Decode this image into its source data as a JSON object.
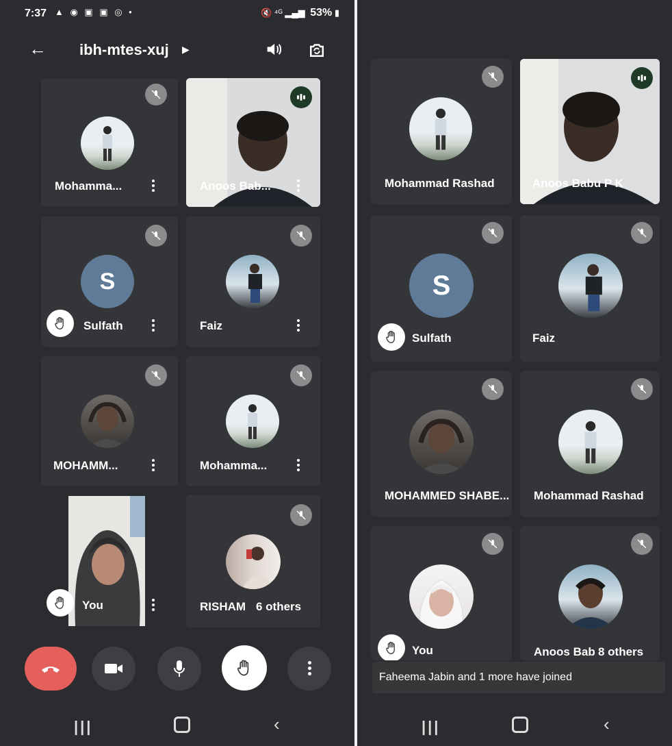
{
  "left": {
    "status": {
      "time": "7:37",
      "battery": "53%"
    },
    "meeting_code": "ibh-mtes-xuj",
    "tiles": [
      {
        "name": "Mohamma..."
      },
      {
        "name": "Anoos Bab..."
      },
      {
        "name": "Sulfath",
        "avatar_letter": "S"
      },
      {
        "name": "Faiz"
      },
      {
        "name": "MOHAMM..."
      },
      {
        "name": "Mohamma..."
      },
      {
        "name": "You"
      },
      {
        "name": "RISHAM",
        "others": "6 others"
      }
    ]
  },
  "right": {
    "tiles": [
      {
        "name": "Mohammad Rashad"
      },
      {
        "name": "Anoos Babu P K"
      },
      {
        "name": "Sulfath",
        "avatar_letter": "S"
      },
      {
        "name": "Faiz"
      },
      {
        "name": "MOHAMMED SHABE..."
      },
      {
        "name": "Mohammad Rashad"
      },
      {
        "name": "You"
      },
      {
        "name": "Anoos Bab",
        "others": "8 others"
      }
    ],
    "toast": "Faheema Jabin and 1 more have joined"
  },
  "colors": {
    "end_call": "#e5605c",
    "background": "#2b2c2f",
    "tile": "#333538",
    "avatar_letter_bg": "#5f7b97"
  },
  "icons": [
    "back-arrow-icon",
    "speaker-icon",
    "camera-switch-icon",
    "mic-off-icon",
    "more-vert-icon",
    "raise-hand-icon",
    "speaking-indicator-icon",
    "end-call-icon",
    "video-icon",
    "mic-icon"
  ]
}
